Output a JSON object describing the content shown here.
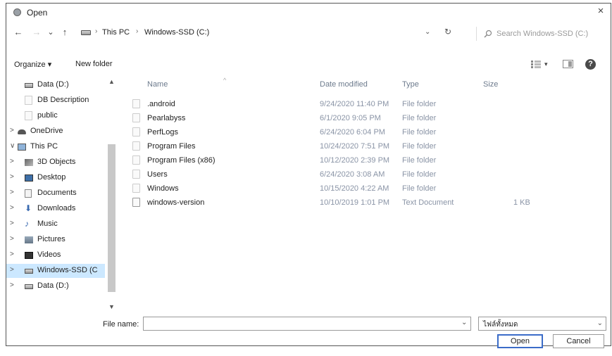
{
  "window": {
    "title": "Open",
    "close_glyph": "×"
  },
  "nav": {
    "back": "←",
    "forward": "→",
    "recent": "⌄",
    "up": "↑",
    "breadcrumb": [
      "This PC",
      "Windows-SSD (C:)"
    ],
    "refresh": "↻",
    "search_placeholder": "Search Windows-SSD (C:)"
  },
  "toolbar": {
    "organize": "Organize ▾",
    "new_folder": "New folder"
  },
  "sidebar": {
    "items": [
      {
        "label": "Data (D:)",
        "icon": "drive-icon",
        "indent": 1,
        "chevron": ""
      },
      {
        "label": "DB Description",
        "icon": "folder-icon",
        "indent": 1,
        "chevron": ""
      },
      {
        "label": "public",
        "icon": "folder-icon",
        "indent": 1,
        "chevron": ""
      },
      {
        "label": "OneDrive",
        "icon": "cloud-icon",
        "indent": 0,
        "chevron": ">"
      },
      {
        "label": "This PC",
        "icon": "computer-icon",
        "indent": 0,
        "chevron": "∨"
      },
      {
        "label": "3D Objects",
        "icon": "cube-icon",
        "indent": 1,
        "chevron": ">"
      },
      {
        "label": "Desktop",
        "icon": "desktop-icon",
        "indent": 1,
        "chevron": ">"
      },
      {
        "label": "Documents",
        "icon": "documents-icon",
        "indent": 1,
        "chevron": ">"
      },
      {
        "label": "Downloads",
        "icon": "download-icon",
        "indent": 1,
        "chevron": ">"
      },
      {
        "label": "Music",
        "icon": "music-icon",
        "indent": 1,
        "chevron": ">"
      },
      {
        "label": "Pictures",
        "icon": "pictures-icon",
        "indent": 1,
        "chevron": ">"
      },
      {
        "label": "Videos",
        "icon": "videos-icon",
        "indent": 1,
        "chevron": ">"
      },
      {
        "label": "Windows-SSD (C",
        "icon": "drive-icon",
        "indent": 1,
        "chevron": ">",
        "selected": true
      },
      {
        "label": "Data (D:)",
        "icon": "drive-icon",
        "indent": 1,
        "chevron": ">"
      }
    ]
  },
  "columns": {
    "name": "Name",
    "date": "Date modified",
    "type": "Type",
    "size": "Size"
  },
  "files": [
    {
      "name": ".android",
      "date": "9/24/2020 11:40 PM",
      "type": "File folder",
      "size": ""
    },
    {
      "name": "Pearlabyss",
      "date": "6/1/2020 9:05 PM",
      "type": "File folder",
      "size": ""
    },
    {
      "name": "PerfLogs",
      "date": "6/24/2020 6:04 PM",
      "type": "File folder",
      "size": ""
    },
    {
      "name": "Program Files",
      "date": "10/24/2020 7:51 PM",
      "type": "File folder",
      "size": ""
    },
    {
      "name": "Program Files (x86)",
      "date": "10/12/2020 2:39 PM",
      "type": "File folder",
      "size": ""
    },
    {
      "name": "Users",
      "date": "6/24/2020 3:08 AM",
      "type": "File folder",
      "size": ""
    },
    {
      "name": "Windows",
      "date": "10/15/2020 4:22 AM",
      "type": "File folder",
      "size": ""
    },
    {
      "name": "windows-version",
      "date": "10/10/2019 1:01 PM",
      "type": "Text Document",
      "size": "1 KB"
    }
  ],
  "footer": {
    "filename_label": "File name:",
    "filename_value": "",
    "filetype_value": "ไฟล์ทั้งหมด",
    "open_label": "Open",
    "cancel_label": "Cancel"
  },
  "colors": {
    "accent": "#3b6cc8",
    "meta_text": "#8a94a6",
    "selected_bg": "#cce8ff"
  }
}
